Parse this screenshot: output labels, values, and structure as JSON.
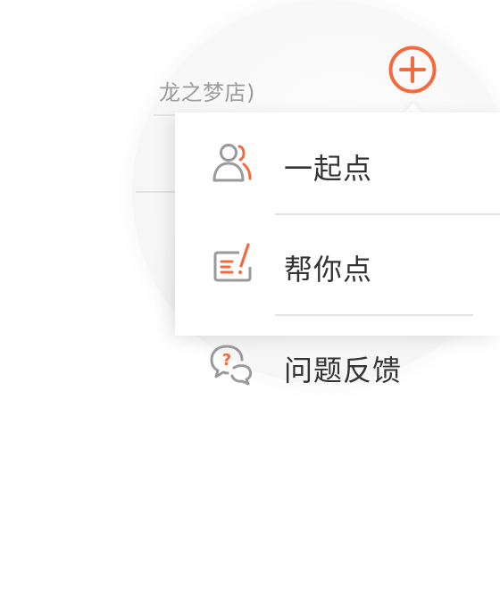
{
  "header": {
    "store_name": "龙之梦店)",
    "add_icon": "plus-circle-icon"
  },
  "menu": {
    "items": [
      {
        "label": "一起点",
        "icon": "group-users-icon"
      },
      {
        "label": "帮你点",
        "icon": "edit-note-icon"
      },
      {
        "label": "问题反馈",
        "icon": "question-chat-icon"
      }
    ]
  },
  "colors": {
    "accent": "#f26a3d",
    "icon_gray": "#9a9a9a",
    "text": "#333333"
  }
}
